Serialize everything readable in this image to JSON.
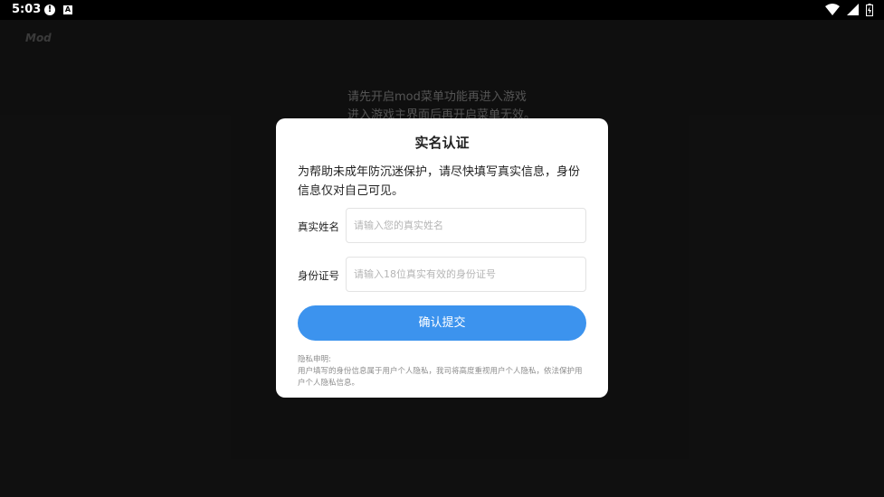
{
  "status_bar": {
    "time": "5:03",
    "alert_glyph": "!",
    "app_glyph": "A",
    "icons": [
      "alert-icon",
      "a-icon",
      "wifi-icon",
      "signal-icon",
      "battery-icon"
    ]
  },
  "app": {
    "logo": "Mod",
    "hint_lines": [
      "请先开启mod菜单功能再进入游戏",
      "进入游戏主界面后再开启菜单无效。"
    ]
  },
  "dialog": {
    "title": "实名认证",
    "description": "为帮助未成年防沉迷保护，请尽快填写真实信息，身份信息仅对自己可见。",
    "name_field": {
      "label": "真实姓名",
      "value": "",
      "placeholder": "请输入您的真实姓名"
    },
    "id_field": {
      "label": "身份证号",
      "value": "",
      "placeholder": "请输入18位真实有效的身份证号"
    },
    "submit_label": "确认提交",
    "privacy_title": "隐私申明:",
    "privacy_text": "用户填写的身份信息属于用户个人隐私，我司将高度重视用户个人隐私，依法保护用户个人隐私信息。"
  },
  "colors": {
    "accent": "#3c93ee",
    "background": "#1d1d1d",
    "dialog": "#ffffff"
  }
}
